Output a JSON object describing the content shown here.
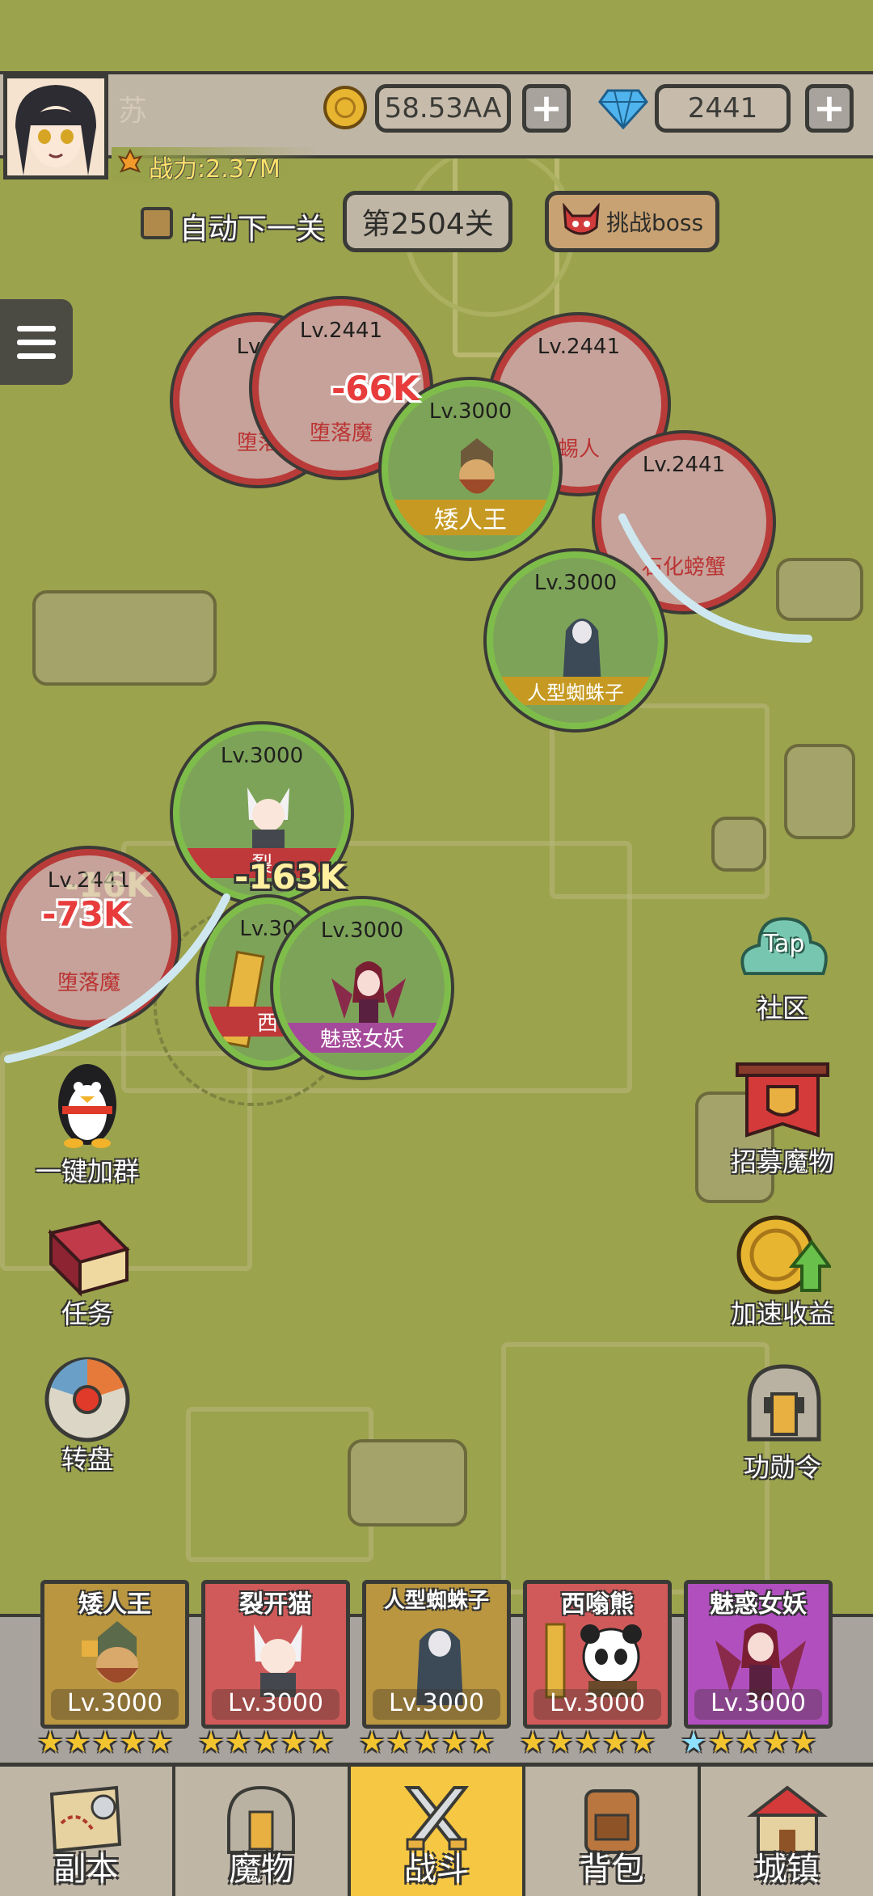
{
  "player": {
    "name": "苏",
    "power": "战力:2.37M",
    "gold": "58.53AA",
    "diamonds": "2441",
    "plus": "+"
  },
  "stage": {
    "auto_next": "自动下一关",
    "stage_label": "第2504关",
    "boss_button": "挑战boss"
  },
  "enemies": [
    {
      "lv": "Lv.2",
      "name": "堕落"
    },
    {
      "lv": "Lv.2441",
      "name": "堕落魔"
    },
    {
      "lv": "Lv.2441",
      "name": "蜴人"
    },
    {
      "lv": "Lv.2441",
      "name": "石化螃蟹"
    },
    {
      "lv": "Lv.2441",
      "name": "堕落魔"
    }
  ],
  "allies_field": [
    {
      "lv": "Lv.3000",
      "name": "矮人王"
    },
    {
      "lv": "Lv.3000",
      "name": "人型蜘蛛子"
    },
    {
      "lv": "Lv.3000",
      "name": "裂"
    },
    {
      "lv": "Lv.30",
      "name": "西"
    },
    {
      "lv": "Lv.3000",
      "name": "魅惑女妖"
    }
  ],
  "damage": [
    "-66K",
    "-163K",
    "-73K",
    "-16K"
  ],
  "side_left": {
    "qq": "一键加群",
    "task": "任务",
    "wheel": "转盘"
  },
  "side_right": {
    "tap_icon": "Tap",
    "community": "社区",
    "recruit": "招募魔物",
    "speedup": "加速收益",
    "merit": "功勋令"
  },
  "roster": [
    {
      "name": "矮人王",
      "lv": "Lv.3000",
      "color": "#b9963f"
    },
    {
      "name": "裂开猫",
      "lv": "Lv.3000",
      "color": "#d05a5a"
    },
    {
      "name": "人型蜘蛛子",
      "lv": "Lv.3000",
      "color": "#b9963f"
    },
    {
      "name": "西嗡熊",
      "lv": "Lv.3000",
      "color": "#d05a5a"
    },
    {
      "name": "魅惑女妖",
      "lv": "Lv.3000",
      "color": "#b14fbf"
    }
  ],
  "nav": {
    "tabs": [
      {
        "label": "副本"
      },
      {
        "label": "魔物"
      },
      {
        "label": "战斗"
      },
      {
        "label": "背包"
      },
      {
        "label": "城镇"
      }
    ],
    "active_index": 2
  }
}
